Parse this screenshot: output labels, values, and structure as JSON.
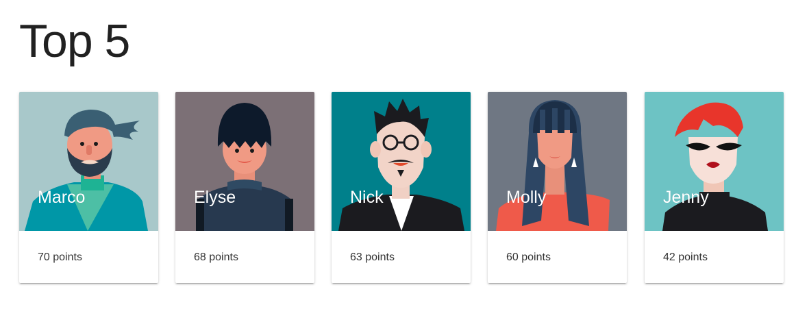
{
  "page": {
    "title": "Top 5"
  },
  "players": [
    {
      "name": "Marco",
      "points": "70 points",
      "bg": "#a8c8ca",
      "avatar": "bearded-man-icon"
    },
    {
      "name": "Elyse",
      "points": "68 points",
      "bg": "#7c7076",
      "avatar": "bob-haircut-woman-icon"
    },
    {
      "name": "Nick",
      "points": "63 points",
      "bg": "#00808b",
      "avatar": "glasses-man-icon"
    },
    {
      "name": "Molly",
      "points": "60 points",
      "bg": "#6f7783",
      "avatar": "long-hair-woman-icon"
    },
    {
      "name": "Jenny",
      "points": "42 points",
      "bg": "#6dc3c4",
      "avatar": "red-hair-woman-icon"
    }
  ]
}
